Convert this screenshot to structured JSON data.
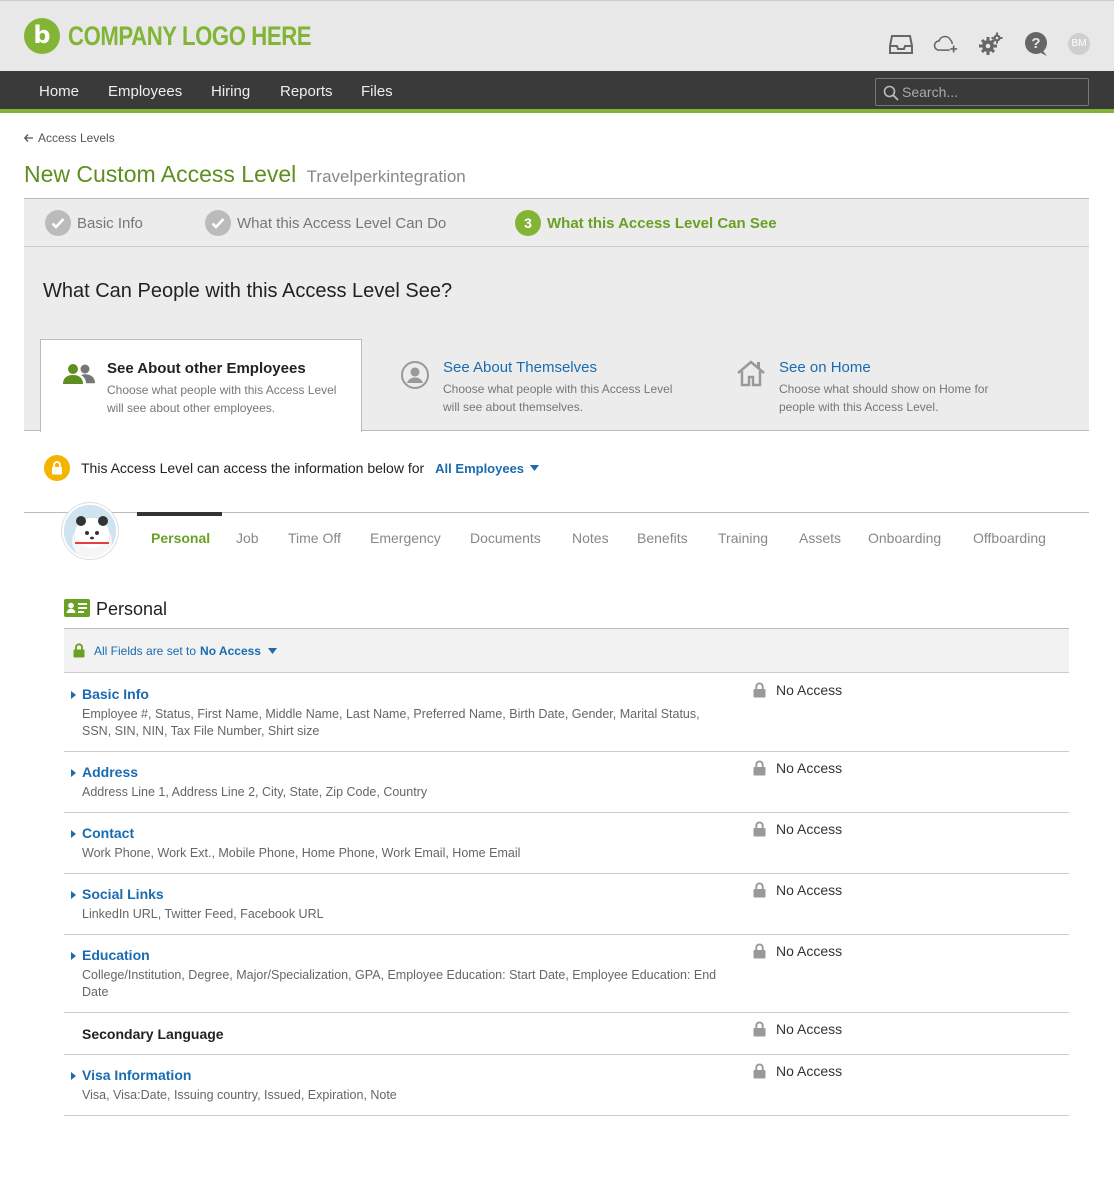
{
  "header": {
    "logo_text": "COMPANY LOGO HERE",
    "logo_glyph": "b",
    "user_initials": "BM",
    "icons": [
      "inbox-icon",
      "cloud-upload-icon",
      "gears-icon",
      "help-icon",
      "user-avatar"
    ]
  },
  "nav": {
    "items": [
      {
        "label": "Home"
      },
      {
        "label": "Employees"
      },
      {
        "label": "Hiring"
      },
      {
        "label": "Reports"
      },
      {
        "label": "Files"
      }
    ],
    "search_placeholder": "Search..."
  },
  "breadcrumb": {
    "label": "Access Levels"
  },
  "page": {
    "title": "New Custom Access Level",
    "subtitle": "Travelperkintegration"
  },
  "steps": [
    {
      "label": "Basic Info",
      "state": "done"
    },
    {
      "label": "What this Access Level Can Do",
      "state": "done"
    },
    {
      "label": "What this Access Level Can See",
      "number": "3",
      "state": "active"
    }
  ],
  "panel": {
    "heading": "What Can People with this Access Level See?",
    "cards": [
      {
        "title": "See About other Employees",
        "desc": "Choose what people with this Access Level will see about other employees."
      },
      {
        "title": "See About Themselves",
        "desc": "Choose what people with this Access Level will see about themselves."
      },
      {
        "title": "See on Home",
        "desc": "Choose what should show on Home for people with this Access Level."
      }
    ]
  },
  "access": {
    "text": "This Access Level can access the information below for",
    "scope": "All Employees"
  },
  "tabs": [
    "Personal",
    "Job",
    "Time Off",
    "Emergency",
    "Documents",
    "Notes",
    "Benefits",
    "Training",
    "Assets",
    "Onboarding",
    "Offboarding"
  ],
  "section": {
    "title": "Personal",
    "fields_prefix": "All Fields are set to",
    "fields_value": "No Access",
    "rows": [
      {
        "title": "Basic Info",
        "desc": "Employee #, Status, First Name, Middle Name, Last Name, Preferred Name, Birth Date, Gender, Marital Status, SSN, SIN, NIN, Tax File Number, Shirt size",
        "access": "No Access"
      },
      {
        "title": "Address",
        "desc": "Address Line 1, Address Line 2, City, State, Zip Code, Country",
        "access": "No Access"
      },
      {
        "title": "Contact",
        "desc": "Work Phone, Work Ext., Mobile Phone, Home Phone, Work Email, Home Email",
        "access": "No Access"
      },
      {
        "title": "Social Links",
        "desc": "LinkedIn URL, Twitter Feed, Facebook URL",
        "access": "No Access"
      },
      {
        "title": "Education",
        "desc": "College/Institution, Degree, Major/Specialization, GPA, Employee Education: Start Date, Employee Education: End Date",
        "access": "No Access"
      },
      {
        "title": "Secondary Language",
        "desc": "",
        "access": "No Access"
      },
      {
        "title": "Visa Information",
        "desc": "Visa, Visa:Date, Issuing country, Issued, Expiration, Note",
        "access": "No Access"
      }
    ]
  },
  "colors": {
    "brand_green": "#82b536",
    "link_blue": "#1a6bb0",
    "nav_bg": "#3a3a3a",
    "lock_yellow": "#f5b400"
  }
}
